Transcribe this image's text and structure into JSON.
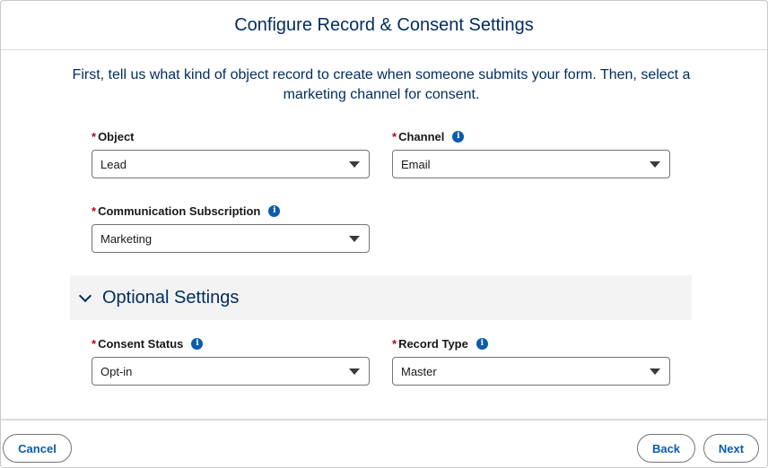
{
  "header": {
    "title": "Configure Record & Consent Settings"
  },
  "intro": "First, tell us what kind of object record to create when someone submits your form. Then, select a marketing channel for consent.",
  "required_marker": "*",
  "fields": {
    "object": {
      "label": "Object",
      "value": "Lead"
    },
    "channel": {
      "label": "Channel",
      "value": "Email"
    },
    "communication_subscription": {
      "label": "Communication Subscription",
      "value": "Marketing"
    },
    "consent_status": {
      "label": "Consent Status",
      "value": "Opt-in"
    },
    "record_type": {
      "label": "Record Type",
      "value": "Master"
    }
  },
  "optional_section": {
    "title": "Optional Settings",
    "expanded": true
  },
  "footer": {
    "cancel_label": "Cancel",
    "back_label": "Back",
    "next_label": "Next"
  },
  "colors": {
    "title": "#032d60",
    "brand_blue": "#0b5cab",
    "required": "#ba0517",
    "section_bg": "#f3f3f3",
    "border": "#747474"
  },
  "icons": {
    "info": "info-icon",
    "dropdown": "chevron-down-icon",
    "section_toggle": "chevron-down-icon"
  }
}
